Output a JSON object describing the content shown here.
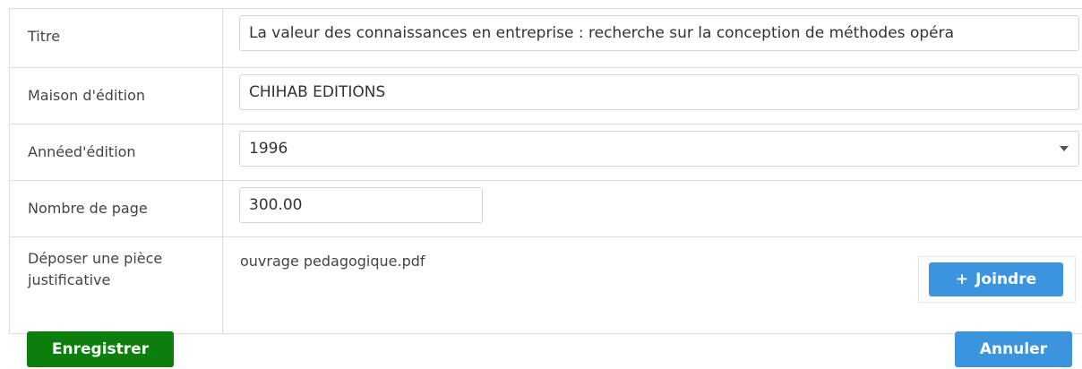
{
  "form": {
    "titre": {
      "label": "Titre",
      "value": "La valeur des connaissances en entreprise : recherche sur la conception de méthodes opéra"
    },
    "maison": {
      "label": "Maison d'édition",
      "value": "CHIHAB EDITIONS"
    },
    "annee": {
      "label": "Annéed'édition",
      "value": "1996"
    },
    "pages": {
      "label": "Nombre de page",
      "value": "300.00"
    },
    "fichier": {
      "label_line1": "Déposer une pièce",
      "label_line2": "justificative",
      "file_name": "ouvrage pedagogique.pdf",
      "join_icon": "+",
      "join_label": "Joindre"
    }
  },
  "actions": {
    "save_label": "Enregistrer",
    "cancel_label": "Annuler"
  },
  "colors": {
    "save": "#0b7e0b",
    "primary": "#3b95de"
  }
}
